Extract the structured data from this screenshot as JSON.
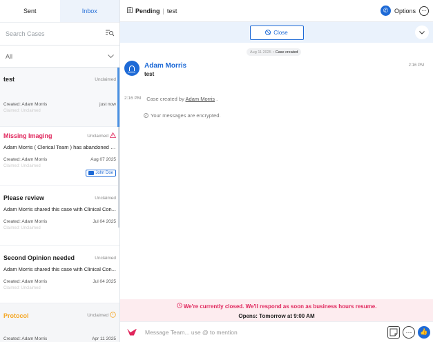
{
  "tabs": {
    "sent": "Sent",
    "inbox": "Inbox"
  },
  "search": {
    "placeholder": "Search Cases",
    "filter_icon": "filter-icon"
  },
  "filter": {
    "selected": "All"
  },
  "cases": [
    {
      "title": "test",
      "status": "Unclaimed",
      "preview": "",
      "created": "Created: Adam Morris",
      "time": "just now",
      "claimed": "Claimed: Unclaimed"
    },
    {
      "title": "Missing Imaging",
      "status": "Unclaimed",
      "preview": "Adam Morris ( Clerical Team ) has abandoned t...",
      "created": "Created: Adam Morris",
      "time": "Aug 07 2025",
      "claimed": "Claimed: Unclaimed",
      "assignee": "John Doe"
    },
    {
      "title": "Please review",
      "status": "Unclaimed",
      "preview": "Adam Morris shared this case with Clinical Con...",
      "created": "Created: Adam Morris",
      "time": "Jul 04 2025",
      "claimed": "Claimed: Unclaimed"
    },
    {
      "title": "Second Opinion needed",
      "status": "Unclaimed",
      "preview": "Adam Morris shared this case with Clinical Con...",
      "created": "Created: Adam Morris",
      "time": "Jul 04 2025",
      "claimed": "Claimed: Unclaimed"
    },
    {
      "title": "Protocol",
      "status": "Unclaimed",
      "preview": "",
      "created": "Created: Adam Morris",
      "time": "Apr 11 2025",
      "claimed": ""
    }
  ],
  "header": {
    "status": "Pending",
    "case_name": "test",
    "options_label": "Options"
  },
  "actions": {
    "close_label": "Close"
  },
  "thread": {
    "date_chip": "Aug 11 2025",
    "date_event": "Case created",
    "sender": "Adam Morris",
    "message": "test",
    "message_time": "2:16 PM",
    "system_time": "2:16 PM",
    "system_prefix": "Case created by",
    "system_user": "Adam Morris",
    "system_suffix": ".",
    "encryption_note": "Your messages are encrypted."
  },
  "notice": {
    "line1": "We're currently closed. We'll respond as soon as business hours resume.",
    "line2": "Opens: Tomorrow at 9:00 AM"
  },
  "composer": {
    "placeholder": "Message Team... use @ to mention"
  },
  "colors": {
    "accent": "#1e6ad6",
    "brand": "#e0265c",
    "warning": "#f5a623",
    "notice_bg": "#fdecef"
  }
}
